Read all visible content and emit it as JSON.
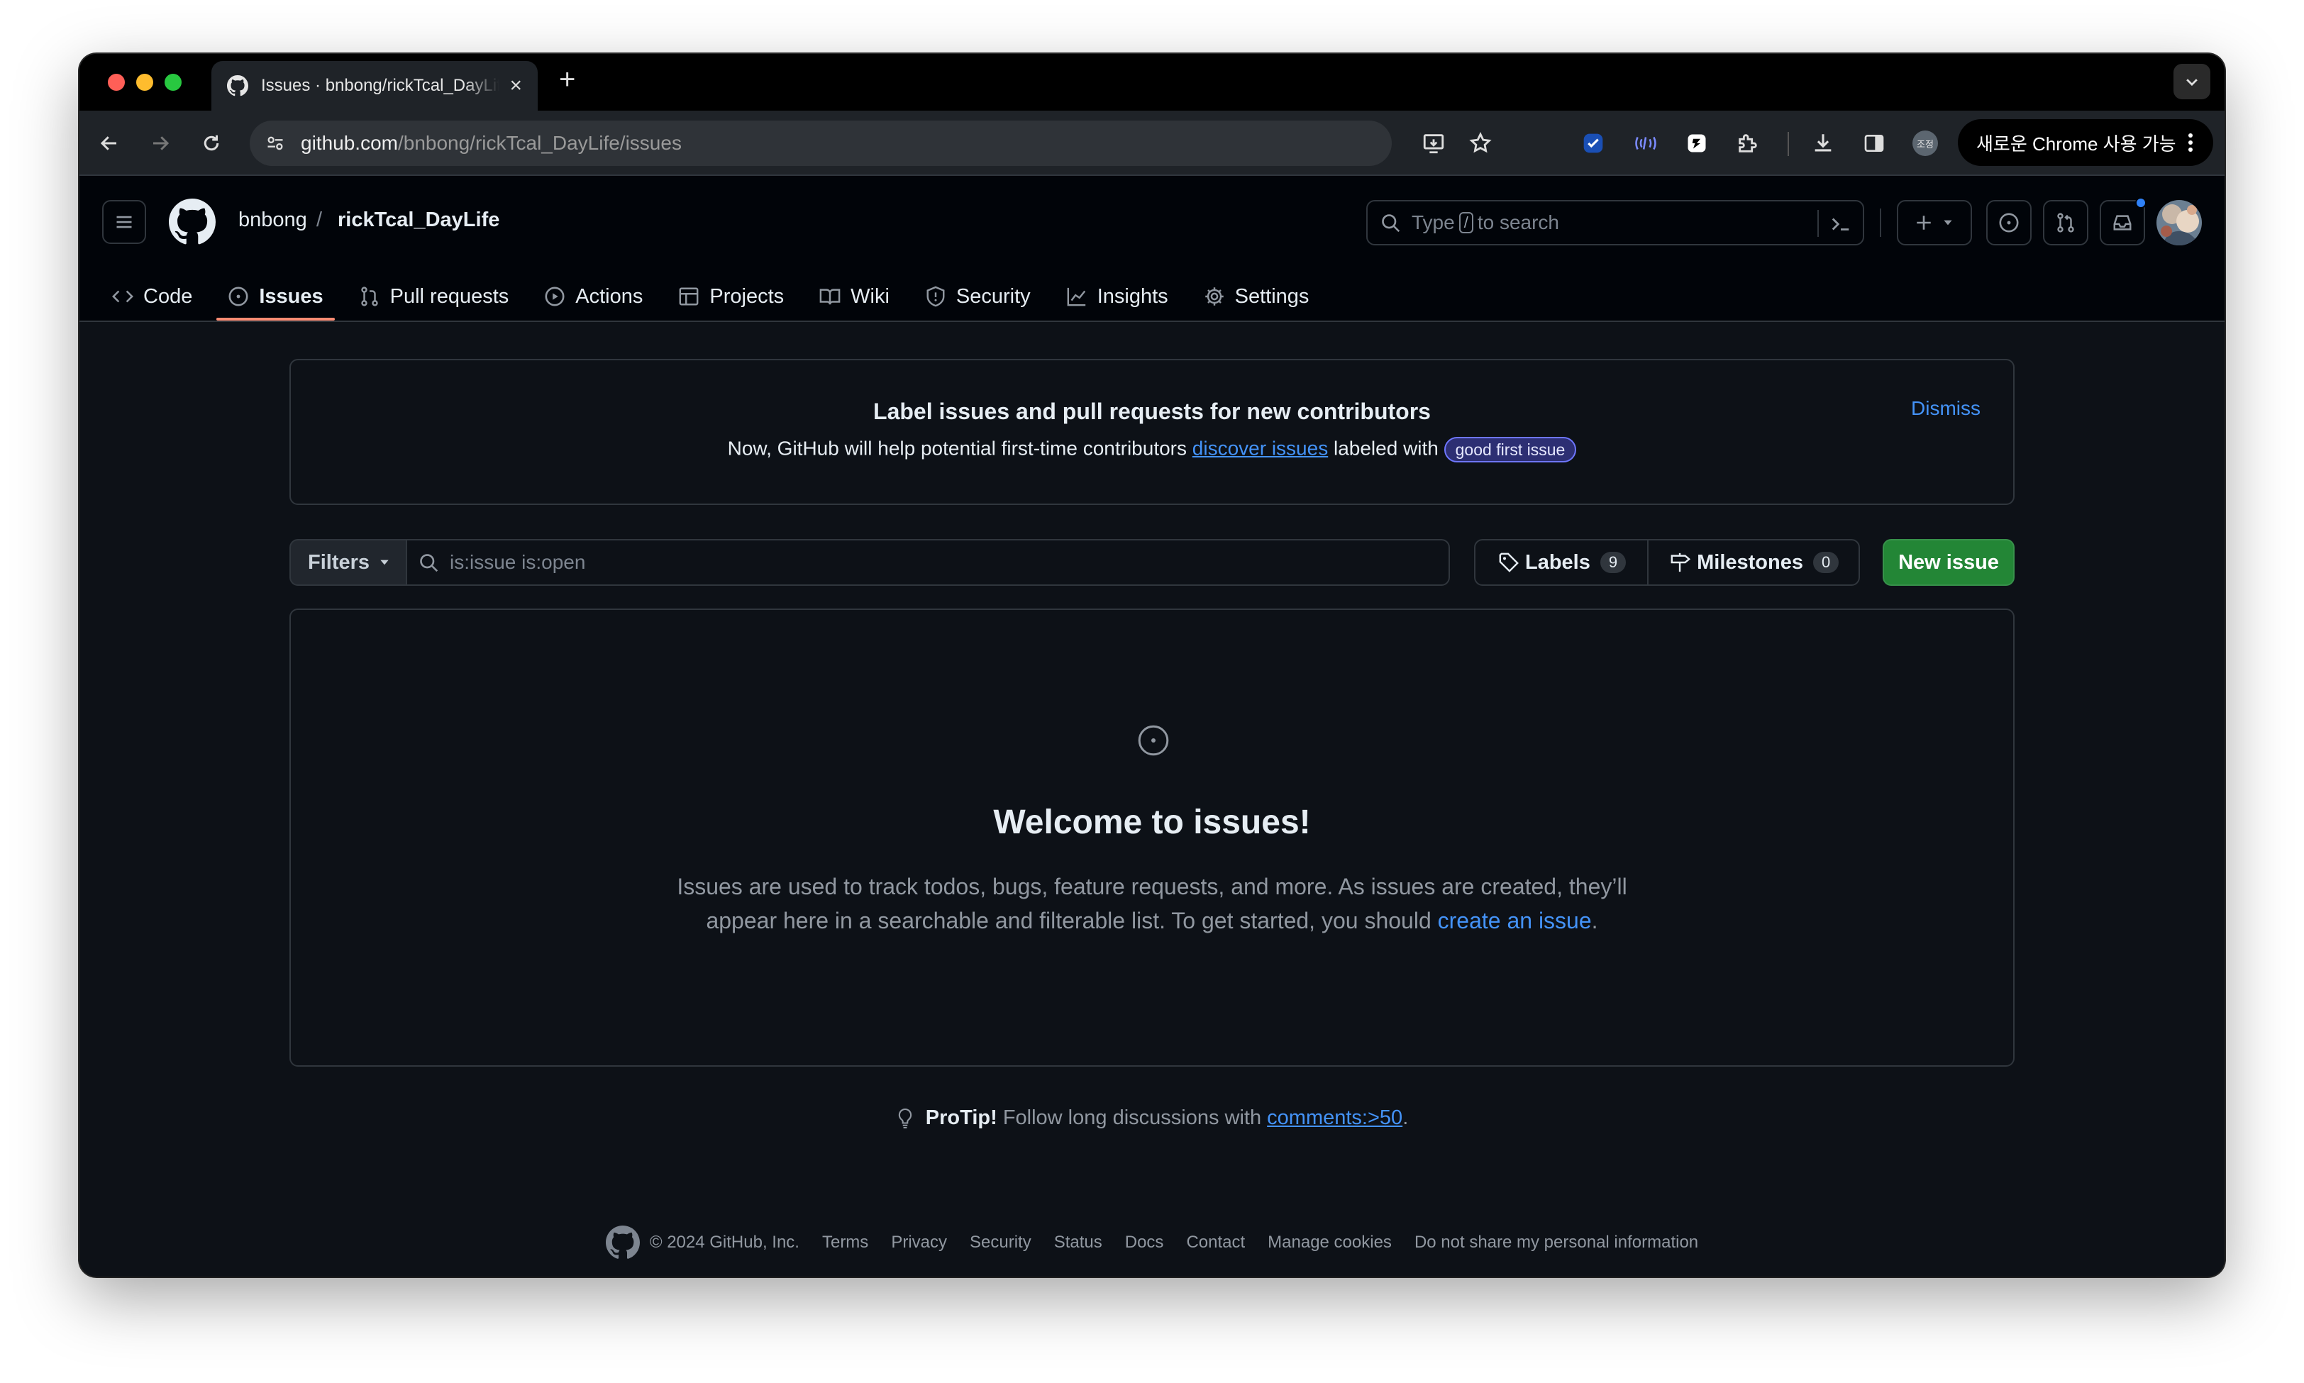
{
  "browser": {
    "tab_title": "Issues · bnbong/rickTcal_DayLife",
    "url_host": "github.com",
    "url_path": "/bnbong/rickTcal_DayLife/issues",
    "profile_label": "조정",
    "update_label": "새로운 Chrome 사용 가능"
  },
  "repo": {
    "owner": "bnbong",
    "separator": "/",
    "name": "rickTcal_DayLife"
  },
  "search": {
    "prefix": "Type",
    "key": "/",
    "suffix": "to search"
  },
  "nav": {
    "code": "Code",
    "issues": "Issues",
    "pulls": "Pull requests",
    "actions": "Actions",
    "projects": "Projects",
    "wiki": "Wiki",
    "security": "Security",
    "insights": "Insights",
    "settings": "Settings"
  },
  "banner": {
    "title": "Label issues and pull requests for new contributors",
    "text_before": "Now, GitHub will help potential first-time contributors",
    "link": "discover issues",
    "text_after": "labeled with",
    "label_badge": "good first issue",
    "dismiss": "Dismiss"
  },
  "filters": {
    "button": "Filters",
    "query": "is:issue is:open",
    "labels_label": "Labels",
    "labels_count": "9",
    "milestones_label": "Milestones",
    "milestones_count": "0",
    "new_issue": "New issue"
  },
  "blankslate": {
    "title": "Welcome to issues!",
    "line1": "Issues are used to track todos, bugs, feature requests, and more. As issues are created, they’ll",
    "line2_before": "appear here in a searchable and filterable list. To get started, you should",
    "line2_link": "create an issue",
    "line2_after": "."
  },
  "protip": {
    "label": "ProTip!",
    "text": "Follow long discussions with",
    "link": "comments:>50",
    "end": "."
  },
  "footer": {
    "copyright": "© 2024 GitHub, Inc.",
    "links": [
      "Terms",
      "Privacy",
      "Security",
      "Status",
      "Docs",
      "Contact",
      "Manage cookies",
      "Do not share my personal information"
    ]
  },
  "colors": {
    "bg": "#0d1117",
    "header_bg": "#010409",
    "accent_blue": "#4493f8",
    "green": "#238636",
    "active_underline": "#fd8c73"
  }
}
